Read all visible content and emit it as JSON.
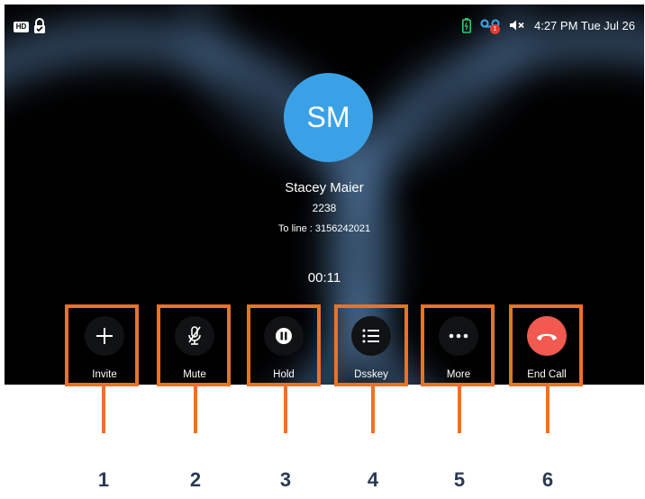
{
  "status_bar": {
    "time_text": "4:27 PM Tue Jul 26",
    "voicemail_count": "1",
    "hd_label": "HD",
    "icons": [
      "hd-icon",
      "lock-icon",
      "battery-icon",
      "voicemail-icon",
      "muted-volume-icon"
    ]
  },
  "call": {
    "avatar_initials": "SM",
    "contact_name": "Stacey Maier",
    "extension": "2238",
    "to_line": "To line : 3156242021",
    "duration": "00:11"
  },
  "buttons": [
    {
      "label": "Invite",
      "icon": "plus-icon"
    },
    {
      "label": "Mute",
      "icon": "microphone-off-icon"
    },
    {
      "label": "Hold",
      "icon": "pause-icon"
    },
    {
      "label": "Dsskey",
      "icon": "list-icon"
    },
    {
      "label": "More",
      "icon": "ellipsis-icon"
    },
    {
      "label": "End Call",
      "icon": "hang-up-icon"
    }
  ],
  "callouts": [
    "1",
    "2",
    "3",
    "4",
    "5",
    "6"
  ],
  "colors": {
    "highlight": "#e8722a",
    "avatar": "#3ba1e6",
    "end_call": "#f15a50",
    "battery": "#2ecc71",
    "voicemail": "#3ba1e6"
  }
}
